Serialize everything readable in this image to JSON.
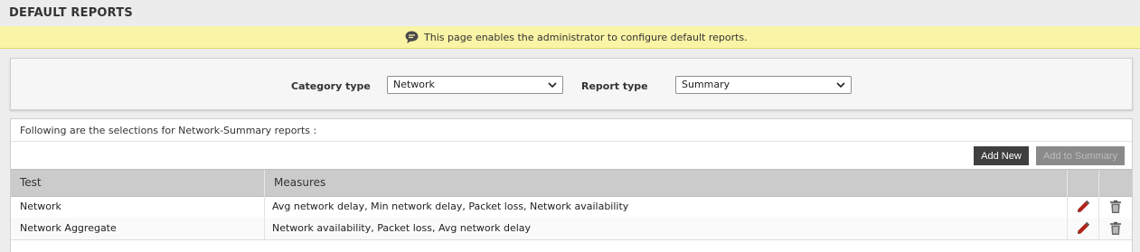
{
  "header": {
    "title": "DEFAULT REPORTS"
  },
  "info": {
    "icon": "speech-bubble-icon",
    "text": "This page enables the administrator to configure default reports."
  },
  "filters": {
    "category_label": "Category type",
    "category_value": "Network",
    "report_label": "Report type",
    "report_value": "Summary"
  },
  "results": {
    "caption": "Following are the selections for Network-Summary reports :",
    "add_new_label": "Add New",
    "add_to_summary_label": "Add to Summary",
    "columns": [
      "Test",
      "Measures"
    ],
    "rows": [
      {
        "test": "Network",
        "measures": "Avg network delay, Min network delay, Packet loss, Network availability",
        "edit_icon": "pencil-icon",
        "delete_icon": "trash-icon"
      },
      {
        "test": "Network Aggregate",
        "measures": "Network availability, Packet loss, Avg network delay",
        "edit_icon": "pencil-icon",
        "delete_icon": "trash-icon"
      }
    ]
  },
  "colors": {
    "info_bg": "#faf4a6",
    "header_bg": "#cbcbcb",
    "button_dark": "#3f3f3f",
    "button_disabled": "#8a8a8a",
    "edit_icon": "#b0231a"
  }
}
